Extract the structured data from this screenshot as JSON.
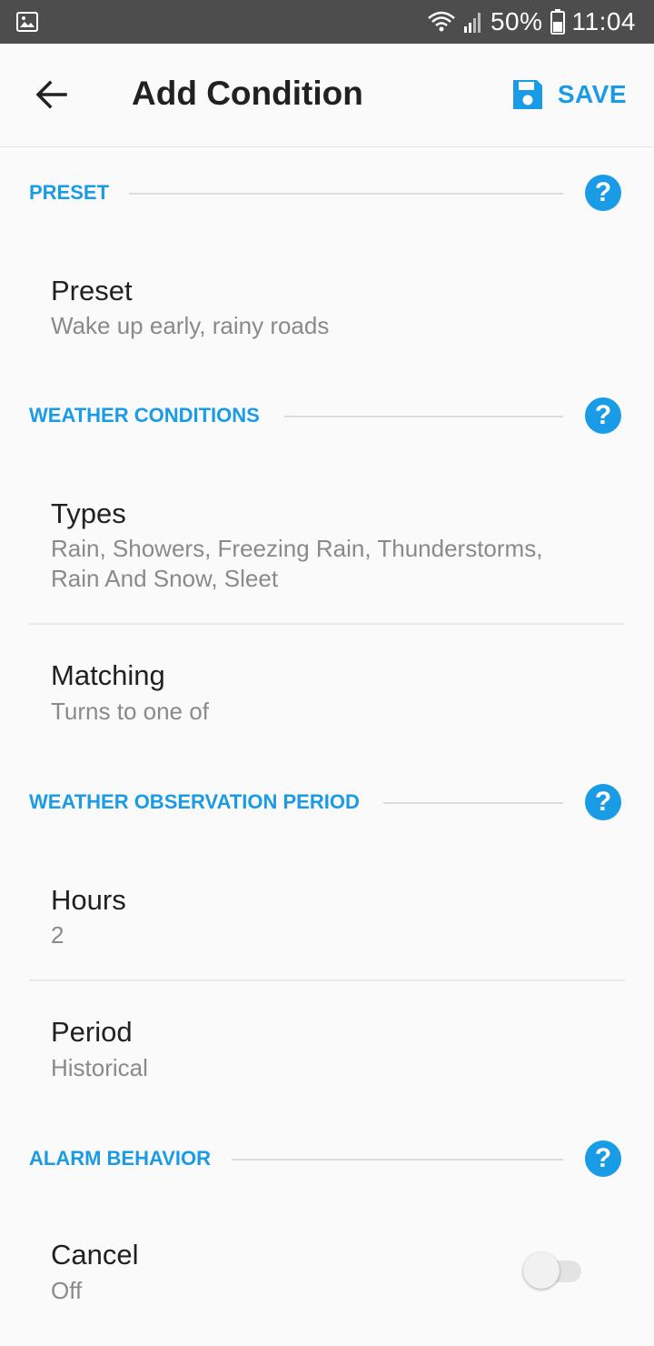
{
  "status_bar": {
    "battery": "50%",
    "time": "11:04",
    "icons": [
      "image-icon",
      "wifi-icon",
      "signal-icon",
      "battery-icon"
    ]
  },
  "app_bar": {
    "title": "Add Condition",
    "save_label": "SAVE",
    "icons": [
      "back-arrow-icon",
      "save-disk-icon"
    ]
  },
  "sections": {
    "preset": {
      "header": "PRESET",
      "items": [
        {
          "title": "Preset",
          "subtitle": "Wake up early, rainy roads"
        }
      ]
    },
    "weather_conditions": {
      "header": "WEATHER CONDITIONS",
      "items": [
        {
          "title": "Types",
          "subtitle_line1": "Rain, Showers, Freezing Rain, Thunderstorms,",
          "subtitle_line2": "Rain And Snow, Sleet"
        },
        {
          "title": "Matching",
          "subtitle": "Turns to one of"
        }
      ]
    },
    "observation_period": {
      "header": "WEATHER OBSERVATION PERIOD",
      "items": [
        {
          "title": "Hours",
          "subtitle": "2"
        },
        {
          "title": "Period",
          "subtitle": "Historical"
        }
      ]
    },
    "alarm_behavior": {
      "header": "ALARM BEHAVIOR",
      "items": [
        {
          "title": "Cancel",
          "subtitle": "Off",
          "toggle_on": false
        }
      ]
    }
  },
  "help_icon_glyph": "?",
  "colors": {
    "accent": "#1a9be6",
    "status_bar": "#4d4d4d",
    "background": "#fafafa",
    "primary_text": "#212121",
    "secondary_text": "#8a8a8a"
  }
}
